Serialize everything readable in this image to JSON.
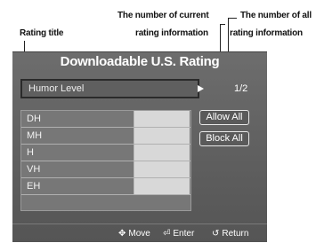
{
  "callouts": {
    "rating_title": "Rating title",
    "current_number_line1": "The number of current",
    "current_number_line2": "rating information",
    "all_number_line1": "The number of all",
    "all_number_line2": "rating information"
  },
  "screen": {
    "title": "Downloadable U.S. Rating",
    "rating_item": "Humor Level",
    "count": "1/2",
    "rows": [
      "DH",
      "MH",
      "H",
      "VH",
      "EH"
    ],
    "buttons": {
      "allow_all": "Allow All",
      "block_all": "Block All"
    },
    "nav": {
      "move": "Move",
      "enter": "Enter",
      "return": "Return"
    }
  }
}
